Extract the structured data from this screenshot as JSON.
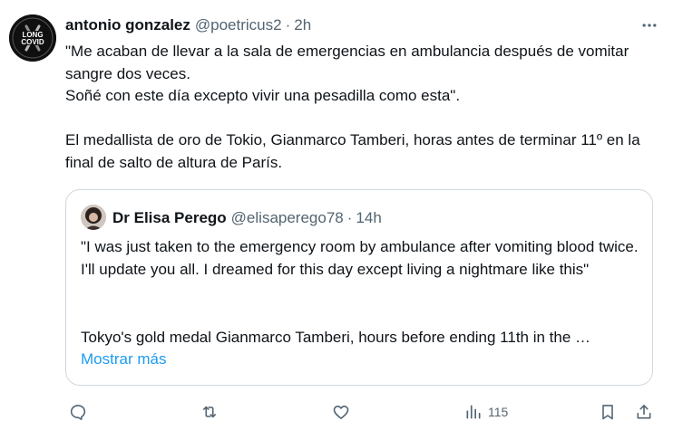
{
  "tweet": {
    "author_name": "antonio gonzalez",
    "author_handle": "@poetricus2",
    "separator": "·",
    "time": "2h",
    "avatar_icon": "long-covid-badge",
    "avatar_text_line1": "LONG",
    "avatar_text_line2": "COVID",
    "text": "\"Me acaban de llevar a la sala de emergencias en ambulancia después de vomitar sangre dos veces.\nSoñé con este día excepto vivir una pesadilla como esta\".\n\nEl medallista de oro de Tokio, Gianmarco Tamberi, horas antes de terminar 11º en la final de salto de altura de París."
  },
  "quote": {
    "author_name": "Dr Elisa Perego",
    "author_handle": "@elisaperego78",
    "separator": "·",
    "time": "14h",
    "text": "\"I was just taken to the emergency room by ambulance after vomiting blood twice. I'll update you all. I dreamed for this day except living a nightmare like this\"",
    "truncated_line": "Tokyo's gold medal Gianmarco Tamberi, hours before ending 11th in the …",
    "show_more_label": "Mostrar más"
  },
  "actions": {
    "reply_icon": "reply-icon",
    "retweet_icon": "retweet-icon",
    "like_icon": "heart-icon",
    "views_icon": "views-icon",
    "views_count": "115",
    "bookmark_icon": "bookmark-icon",
    "share_icon": "share-icon"
  },
  "colors": {
    "text": "#0f1419",
    "secondary": "#536471",
    "link": "#1d9bf0",
    "border": "#cfd9de"
  }
}
